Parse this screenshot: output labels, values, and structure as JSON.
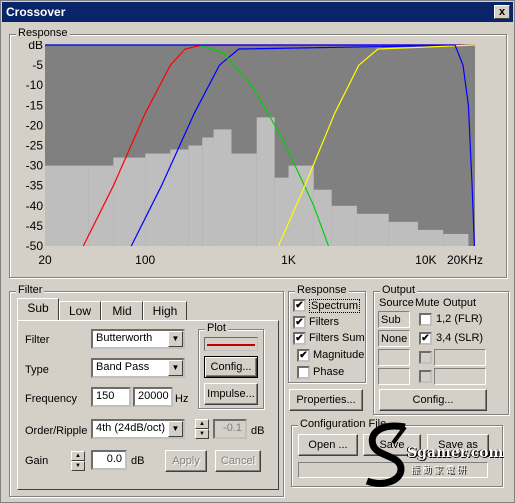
{
  "window": {
    "title": "Crossover",
    "close_label": "x"
  },
  "response_group": {
    "label": "Response"
  },
  "chart_data": {
    "type": "line",
    "xscale": "log",
    "xlim": [
      20,
      20000
    ],
    "ylim": [
      -50,
      0
    ],
    "xticks": [
      "20",
      "100",
      "1K",
      "10K",
      "20KHz"
    ],
    "yticks": [
      "dB",
      "-5",
      "-10",
      "-15",
      "-20",
      "-25",
      "-30",
      "-35",
      "-40",
      "-45",
      "-50"
    ],
    "series": [
      {
        "color": "#ff0000",
        "x": [
          37,
          60,
          100,
          150,
          190,
          250,
          20000
        ],
        "y": [
          -50,
          -35,
          -17,
          -5,
          -1,
          0,
          0
        ]
      },
      {
        "color": "#0000ff",
        "x": [
          80,
          130,
          220,
          330,
          450,
          20000
        ],
        "y": [
          -50,
          -35,
          -17,
          -5,
          -1,
          0
        ]
      },
      {
        "color": "#00d000",
        "x": [
          20,
          240,
          350,
          550,
          900,
          1500,
          1900
        ],
        "y": [
          0,
          0,
          -2,
          -10,
          -23,
          -40,
          -50
        ]
      },
      {
        "color": "#ffff00",
        "x": [
          850,
          1300,
          2100,
          3100,
          4200,
          20000
        ],
        "y": [
          -50,
          -35,
          -17,
          -5,
          -1,
          0
        ]
      },
      {
        "color": "#0000ff",
        "x": [
          20,
          14500,
          16500,
          18000,
          19100,
          19800
        ],
        "y": [
          0,
          0,
          -5,
          -15,
          -35,
          -50
        ]
      }
    ],
    "spectrum": {
      "color": "#bebebe",
      "x": [
        20,
        40,
        60,
        100,
        150,
        200,
        250,
        300,
        400,
        600,
        800,
        1000,
        1500,
        2000,
        3000,
        5000,
        8000,
        12000,
        18000
      ],
      "y": [
        -30,
        -30,
        -28,
        -27,
        -26,
        -25,
        -23,
        -21,
        -27,
        -18,
        -33,
        -30,
        -36,
        -40,
        -42,
        -44,
        -46,
        -47,
        -48
      ]
    }
  },
  "filter": {
    "group_label": "Filter",
    "tabs": [
      "Sub",
      "Low",
      "Mid",
      "High"
    ],
    "filter_label": "Filter",
    "filter_value": "Butterworth",
    "type_label": "Type",
    "type_value": "Band Pass",
    "frequency_label": "Frequency",
    "freq_low": "150",
    "freq_high": "20000",
    "hz_label": "Hz",
    "order_label": "Order/Ripple",
    "order_value": "4th (24dB/oct)",
    "ripple_value": "-0.1",
    "db_label": "dB",
    "gain_label": "Gain",
    "gain_value": "0.0",
    "gain_db_label": "dB",
    "apply_label": "Apply",
    "cancel_label": "Cancel",
    "plot_group_label": "Plot",
    "config_label": "Config...",
    "impulse_label": "Impulse..."
  },
  "response_panel": {
    "label": "Response",
    "spectrum_label": "Spectrum",
    "spectrum_checked": "✔",
    "filters_label": "Filters",
    "filters_checked": "✔",
    "filters_sum_label": "Filters Sum",
    "filters_sum_checked": "✔",
    "magnitude_label": "Magnitude",
    "magnitude_checked": "✔",
    "phase_label": "Phase",
    "properties_label": "Properties..."
  },
  "output": {
    "label": "Output",
    "col_source": "Source",
    "col_mute": "Mute",
    "col_output": "Output",
    "rows": [
      {
        "source": "Sub",
        "mute": "",
        "output": "1,2 (FLR)"
      },
      {
        "source": "None",
        "mute": "✔",
        "output": "3,4 (SLR)"
      }
    ],
    "config_label": "Config..."
  },
  "config_file": {
    "label": "Configuration File",
    "open_label": "Open ...",
    "save_label": "Save",
    "save_as_label": "Save as",
    "watermark_text": "Sgamer.com",
    "watermark_sub": "振 動 家 電 研"
  }
}
